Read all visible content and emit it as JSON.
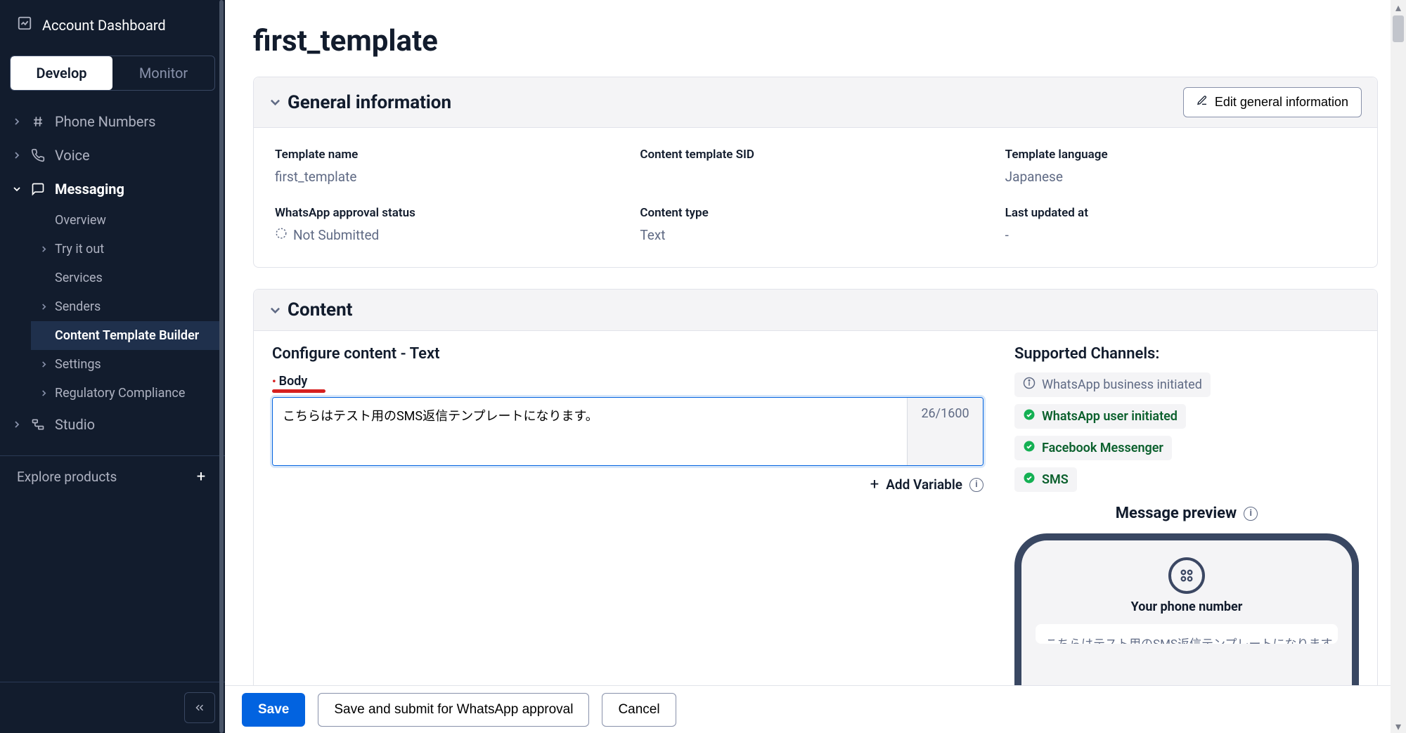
{
  "sidebar": {
    "dashboard": "Account Dashboard",
    "tab_develop": "Develop",
    "tab_monitor": "Monitor",
    "phone_numbers": "Phone Numbers",
    "voice": "Voice",
    "messaging": "Messaging",
    "messaging_items": {
      "overview": "Overview",
      "try_it_out": "Try it out",
      "services": "Services",
      "senders": "Senders",
      "content_template_builder": "Content Template Builder",
      "settings": "Settings",
      "regulatory_compliance": "Regulatory Compliance"
    },
    "studio": "Studio",
    "explore": "Explore products"
  },
  "page": {
    "title": "first_template"
  },
  "general": {
    "header": "General information",
    "edit_button": "Edit general information",
    "template_name_label": "Template name",
    "template_name_value": "first_template",
    "sid_label": "Content template SID",
    "sid_value": "",
    "language_label": "Template language",
    "language_value": "Japanese",
    "wa_status_label": "WhatsApp approval status",
    "wa_status_value": "Not Submitted",
    "content_type_label": "Content type",
    "content_type_value": "Text",
    "updated_label": "Last updated at",
    "updated_value": "-"
  },
  "content": {
    "header": "Content",
    "configure_title": "Configure content - Text",
    "body_label": "Body",
    "body_value": "こちらはテスト用のSMS返信テンプレートになります。",
    "char_count": "26/1600",
    "add_variable": "Add Variable",
    "supported_title": "Supported Channels:",
    "channels": {
      "wa_business": "WhatsApp business initiated",
      "wa_user": "WhatsApp user initiated",
      "fb": "Facebook Messenger",
      "sms": "SMS"
    },
    "preview_title": "Message preview",
    "phone_label": "Your phone number"
  },
  "footer": {
    "save": "Save",
    "save_submit": "Save and submit for WhatsApp approval",
    "cancel": "Cancel"
  }
}
